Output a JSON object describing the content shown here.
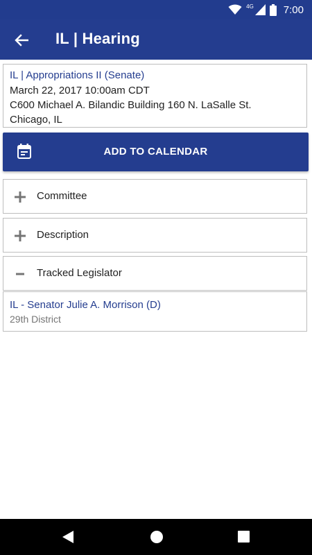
{
  "status_bar": {
    "time": "7:00",
    "network": "4G"
  },
  "app_bar": {
    "title": "IL | Hearing"
  },
  "hearing": {
    "title": "IL | Appropriations II (Senate)",
    "datetime": "March 22, 2017 10:00am CDT",
    "address_line1": "C600 Michael A. Bilandic Building 160 N. LaSalle St.",
    "address_line2": "Chicago, IL"
  },
  "calendar_button": {
    "label": "ADD TO CALENDAR"
  },
  "sections": {
    "committee": {
      "label": "Committee",
      "expanded": false
    },
    "description": {
      "label": "Description",
      "expanded": false
    },
    "tracked_legislator": {
      "label": "Tracked Legislator",
      "expanded": true
    }
  },
  "legislator": {
    "name": "IL - Senator Julie A. Morrison (D)",
    "district": "29th District"
  },
  "colors": {
    "primary": "#243d8f",
    "status_bar": "#223c8e",
    "border": "#bdbdbd",
    "icon_gray": "#757575"
  }
}
